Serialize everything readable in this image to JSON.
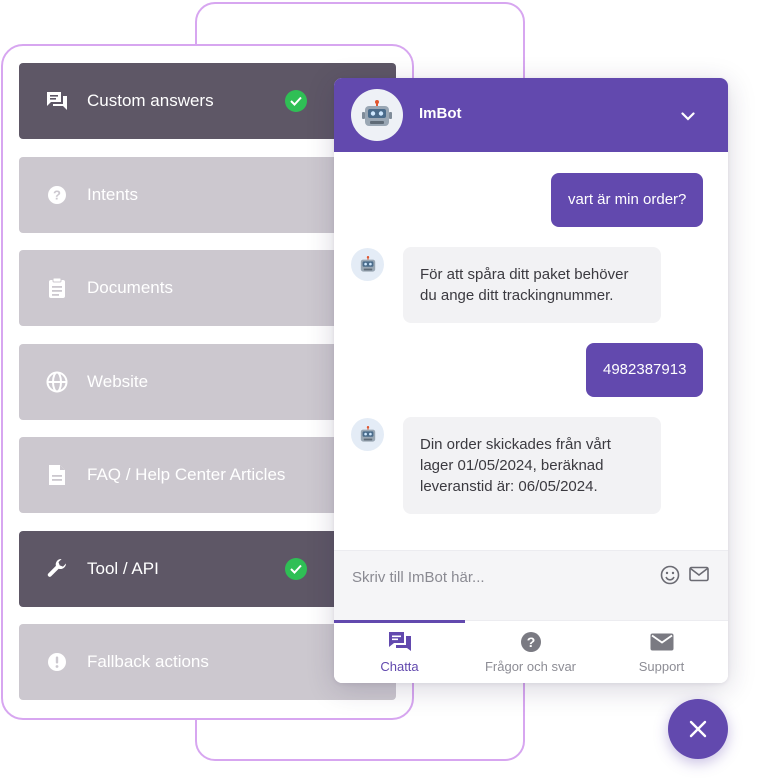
{
  "sources": [
    {
      "label": "Custom answers",
      "icon": "chat-bubbles-icon",
      "active": true,
      "checked": true
    },
    {
      "label": "Intents",
      "icon": "question-circle-icon",
      "active": false,
      "checked": false
    },
    {
      "label": "Documents",
      "icon": "clipboard-icon",
      "active": false,
      "checked": false
    },
    {
      "label": "Website",
      "icon": "globe-icon",
      "active": false,
      "checked": false
    },
    {
      "label": "FAQ / Help Center Articles",
      "icon": "document-icon",
      "active": false,
      "checked": false
    },
    {
      "label": "Tool / API",
      "icon": "wrench-icon",
      "active": true,
      "checked": true
    },
    {
      "label": "Fallback actions",
      "icon": "exclamation-circle-icon",
      "active": false,
      "checked": false
    }
  ],
  "chat": {
    "bot_name": "ImBot",
    "messages": [
      {
        "from": "user",
        "text": "vart är min order?"
      },
      {
        "from": "bot",
        "lines": [
          "För att spåra ditt paket behöver",
          "du ange ditt trackingnummer."
        ]
      },
      {
        "from": "user",
        "text": "4982387913"
      },
      {
        "from": "bot",
        "lines": [
          "Din order skickades från vårt",
          "lager 01/05/2024, beräknad",
          "leveranstid är: 06/05/2024."
        ]
      }
    ],
    "composer_placeholder": "Skriv till ImBot här...",
    "tabs": [
      {
        "label": "Chatta",
        "icon": "chat-icon",
        "active": true
      },
      {
        "label": "Frågor och svar",
        "icon": "question-circle-icon",
        "active": false
      },
      {
        "label": "Support",
        "icon": "mail-icon",
        "active": false
      }
    ]
  },
  "colors": {
    "brand": "#6249ae",
    "item_active": "#5e5766",
    "item_inactive": "#ccc8cf",
    "check": "#2fbf55",
    "frame": "#d7a6f0"
  }
}
